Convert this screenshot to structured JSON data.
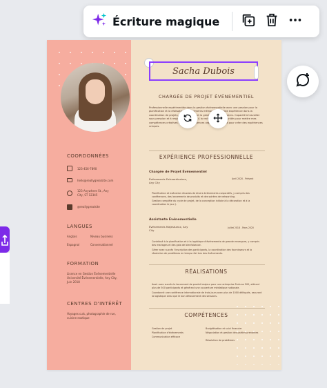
{
  "toolbar": {
    "magic_label": "Écriture magique",
    "icons": [
      "sparkle-icon",
      "duplicate-icon",
      "trash-icon",
      "more-icon"
    ]
  },
  "resume": {
    "name": "Sacha Dubois",
    "job_title": "CHARGÉE DE PROJET ÉVÉNEMENTIEL",
    "intro": "Professionnelle expérimentée dans la gestion événementielle avec une passion pour la planification et la réalisation d'événements mémorables. Solide expérience dans la coordination de projets, l'organisation et la gestion des prestataires. Capacité à travailler sous pression et à respecter les délais. À la recherche d'opportunités pour mettre mes compétences créatives et mes compétences organisationnelles pour créer des expériences uniques.",
    "left": {
      "contact_title": "COORDONNÉES",
      "phone": "123-456-7890",
      "email": "hello@reallygreatsite.com",
      "address": "123 Anywhere St., Any City, ST 12345",
      "website": "@reallygreatsite",
      "languages_title": "LANGUES",
      "languages": [
        {
          "lang": "Anglais",
          "level": "Niveau business"
        },
        {
          "lang": "Espagnol",
          "level": "Conversationnel"
        }
      ],
      "education_title": "FORMATION",
      "education": "Licence en Gestion Événementielle Université Événementielle, Any City, Juin 2018",
      "interests_title": "CENTRES D'INTÉRÊT",
      "interests": "Voyages culs, photographie de rue, cuisine exotique"
    },
    "experience_title": "EXPÉRIENCE PROFESSIONNELLE",
    "jobs": [
      {
        "title": "Chargée de Projet Événementiel",
        "company": "Événements Extraordinaires, Any City",
        "dates": "Avril 2020 - Présent",
        "bullets": [
          "Planification et exécution réussies de divers événements corporatifs, y compris des conférences, des lancements de produits et des soirées de networking.",
          "Gestion complète du cycle de projet, de la conception initiale à la décoration et à la coordination le jour J."
        ]
      },
      {
        "title": "Assistante Événementielle",
        "company": "Événements Majestueux, Any City",
        "dates": "Juillet 2018 - Mars 2020",
        "bullets": [
          "Contribué à la planification et à la logistique d'événements de grande envergure, y compris des mariages et des gala de bienfaisance.",
          "Gérer avec succès l'inscription des participants, la coordination des fournisseurs et la résolution de problèmes en temps réel lors des événements."
        ]
      }
    ],
    "achievements_title": "RÉALISATIONS",
    "achievements": [
      "Avoir avec succès le lancement de produit majeur pour une entreprise Fortune 500, attirant plus de 500 participants et générant une couverture médiatique nationale.",
      "Coordonné une conférence internationale de trois jours avec plus de 1000 délégués, assurant la logistique ainsi que le bon déroulement des sessions."
    ],
    "skills_title": "COMPÉTENCES",
    "skills_left": [
      "Gestion de projet",
      "Planification d'événements",
      "Communication efficace"
    ],
    "skills_right": [
      "Budgétisation et suivi financier",
      "Négociation et gestion des parties prenantes",
      "Résolution de problèmes"
    ]
  }
}
